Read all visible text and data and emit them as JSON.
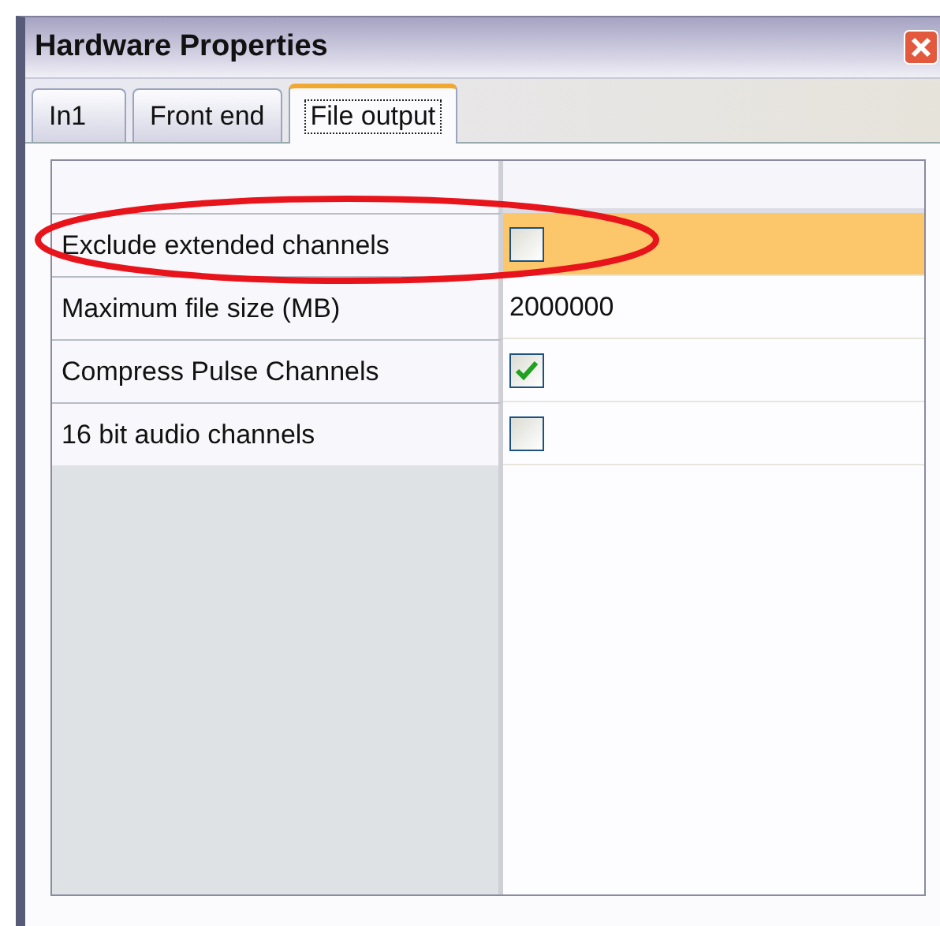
{
  "window": {
    "title": "Hardware Properties"
  },
  "tabs": [
    {
      "label": "In1",
      "selected": false
    },
    {
      "label": "Front end",
      "selected": false
    },
    {
      "label": "File output",
      "selected": true
    }
  ],
  "properties": [
    {
      "label": "Exclude extended channels",
      "kind": "checkbox",
      "checked": false,
      "selected": true
    },
    {
      "label": "Maximum file size (MB)",
      "kind": "text",
      "value": "2000000",
      "selected": false
    },
    {
      "label": "Compress Pulse Channels",
      "kind": "checkbox",
      "checked": true,
      "selected": false
    },
    {
      "label": "16 bit audio channels",
      "kind": "checkbox",
      "checked": false,
      "selected": false
    }
  ]
}
